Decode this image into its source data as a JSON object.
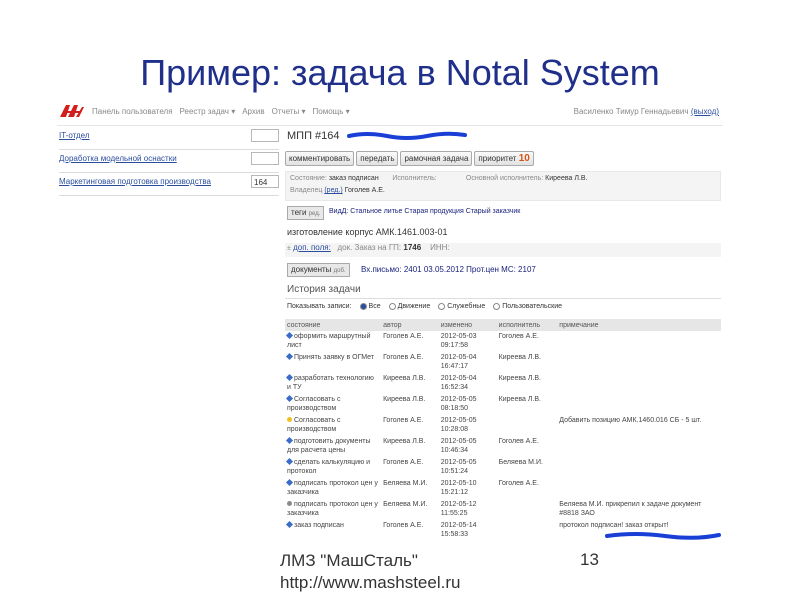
{
  "slide": {
    "title": "Пример: задача в Notal System",
    "footer_line1": "ЛМЗ \"МашСталь\"",
    "footer_line2": "http://www.mashsteel.ru",
    "page_number": "13"
  },
  "app": {
    "nav": [
      "Панель пользователя",
      "Реестр задач ▾",
      "Архив",
      "Отчеты ▾",
      "Помощь ▾"
    ],
    "user_name": "Василенко Тимур Геннадьевич",
    "logout": "(выход)"
  },
  "left_list": [
    {
      "label": "IT-отдел",
      "count": ""
    },
    {
      "label": "Доработка модельной оснастки",
      "count": ""
    },
    {
      "label": "Маркетинговая подготовка производства",
      "count": "164"
    }
  ],
  "task": {
    "id": "МПП #164",
    "buttons": {
      "comment": "комментировать",
      "transfer": "передать",
      "frame": "рамочная задача",
      "priority_label": "приоритет",
      "priority_value": "10"
    },
    "state_label": "Состояние:",
    "state_value": "заказ подписан",
    "executor_label": "Исполнитель:",
    "executor_value": "",
    "main_executor_label": "Основной исполнитель:",
    "main_executor_value": "Киреева Л.В.",
    "owner_label": "Владелец",
    "owner_edit": "(ред.)",
    "owner_value": "Гоголев А.Е.",
    "tags_button": "теги",
    "tags_button_sub": "ред.",
    "tags": "ВидД: Стальное литье  Старая продукция  Старый заказчик",
    "product": "изготовление корпус АМК.1461.003-01",
    "extra_fields_link": "доп. поля:",
    "order_doc_label": "док. Заказ на ГП:",
    "order_doc_value": "1746",
    "inn_label": "ИНН:",
    "docs_button": "документы",
    "docs_button_sub": "доб.",
    "docs": "Вх.письмо: 2401 03.05.2012   Прот.цен МС: 2107"
  },
  "history": {
    "title": "История задачи",
    "filter_label": "Показывать записи:",
    "filters": [
      {
        "label": "Все",
        "on": true
      },
      {
        "label": "Движение",
        "on": false
      },
      {
        "label": "Служебные",
        "on": false
      },
      {
        "label": "Пользовательские",
        "on": false
      }
    ],
    "columns": [
      "состояние",
      "автор",
      "изменено",
      "исполнитель",
      "примечание"
    ],
    "rows": [
      {
        "icon": "arrow",
        "state": "оформить маршрутный лист",
        "author": "Гоголев А.Е.",
        "date": "2012-05-03",
        "time": "09:17:58",
        "executor": "Гоголев А.Е.",
        "note": ""
      },
      {
        "icon": "arrow",
        "state": "Принять заявку в ОГМет",
        "author": "Гоголев А.Е.",
        "date": "2012-05-04",
        "time": "16:47:17",
        "executor": "Киреева Л.В.",
        "note": ""
      },
      {
        "icon": "arrow",
        "state": "разработать технологию и ТУ",
        "author": "Киреева Л.В.",
        "date": "2012-05-04",
        "time": "16:52:34",
        "executor": "Киреева Л.В.",
        "note": ""
      },
      {
        "icon": "arrow",
        "state": "Согласовать с производством",
        "author": "Киреева Л.В.",
        "date": "2012-05-05",
        "time": "08:18:50",
        "executor": "Киреева Л.В.",
        "note": ""
      },
      {
        "icon": "bulb",
        "state": "Согласовать с производством",
        "author": "Гоголев А.Е.",
        "date": "2012-05-05",
        "time": "10:28:08",
        "executor": "",
        "note": "Добавить позицию АМК.1460.016 СБ - 5 шт."
      },
      {
        "icon": "arrow",
        "state": "подготовить документы для расчета цены",
        "author": "Киреева Л.В.",
        "date": "2012-05-05",
        "time": "10:46:34",
        "executor": "Гоголев А.Е.",
        "note": ""
      },
      {
        "icon": "arrow",
        "state": "сделать калькуляцию и протокол",
        "author": "Гоголев А.Е.",
        "date": "2012-05-05",
        "time": "10:51:24",
        "executor": "Беляева М.И.",
        "note": ""
      },
      {
        "icon": "arrow",
        "state": "подписать протокол цен у заказчика",
        "author": "Беляева М.И.",
        "date": "2012-05-10",
        "time": "15:21:12",
        "executor": "Гоголев А.Е.",
        "note": ""
      },
      {
        "icon": "gear",
        "state": "подписать протокол цен у заказчика",
        "author": "Беляева М.И.",
        "date": "2012-05-12",
        "time": "11:55:25",
        "executor": "",
        "note": "Беляева М.И. прикрепил к задаче документ #8818 ЗАО"
      },
      {
        "icon": "arrow",
        "state": "заказ подписан",
        "author": "Гоголев А.Е.",
        "date": "2012-05-14",
        "time": "15:58:33",
        "executor": "",
        "note": "протокол подписан! заказ открыт!"
      }
    ]
  }
}
